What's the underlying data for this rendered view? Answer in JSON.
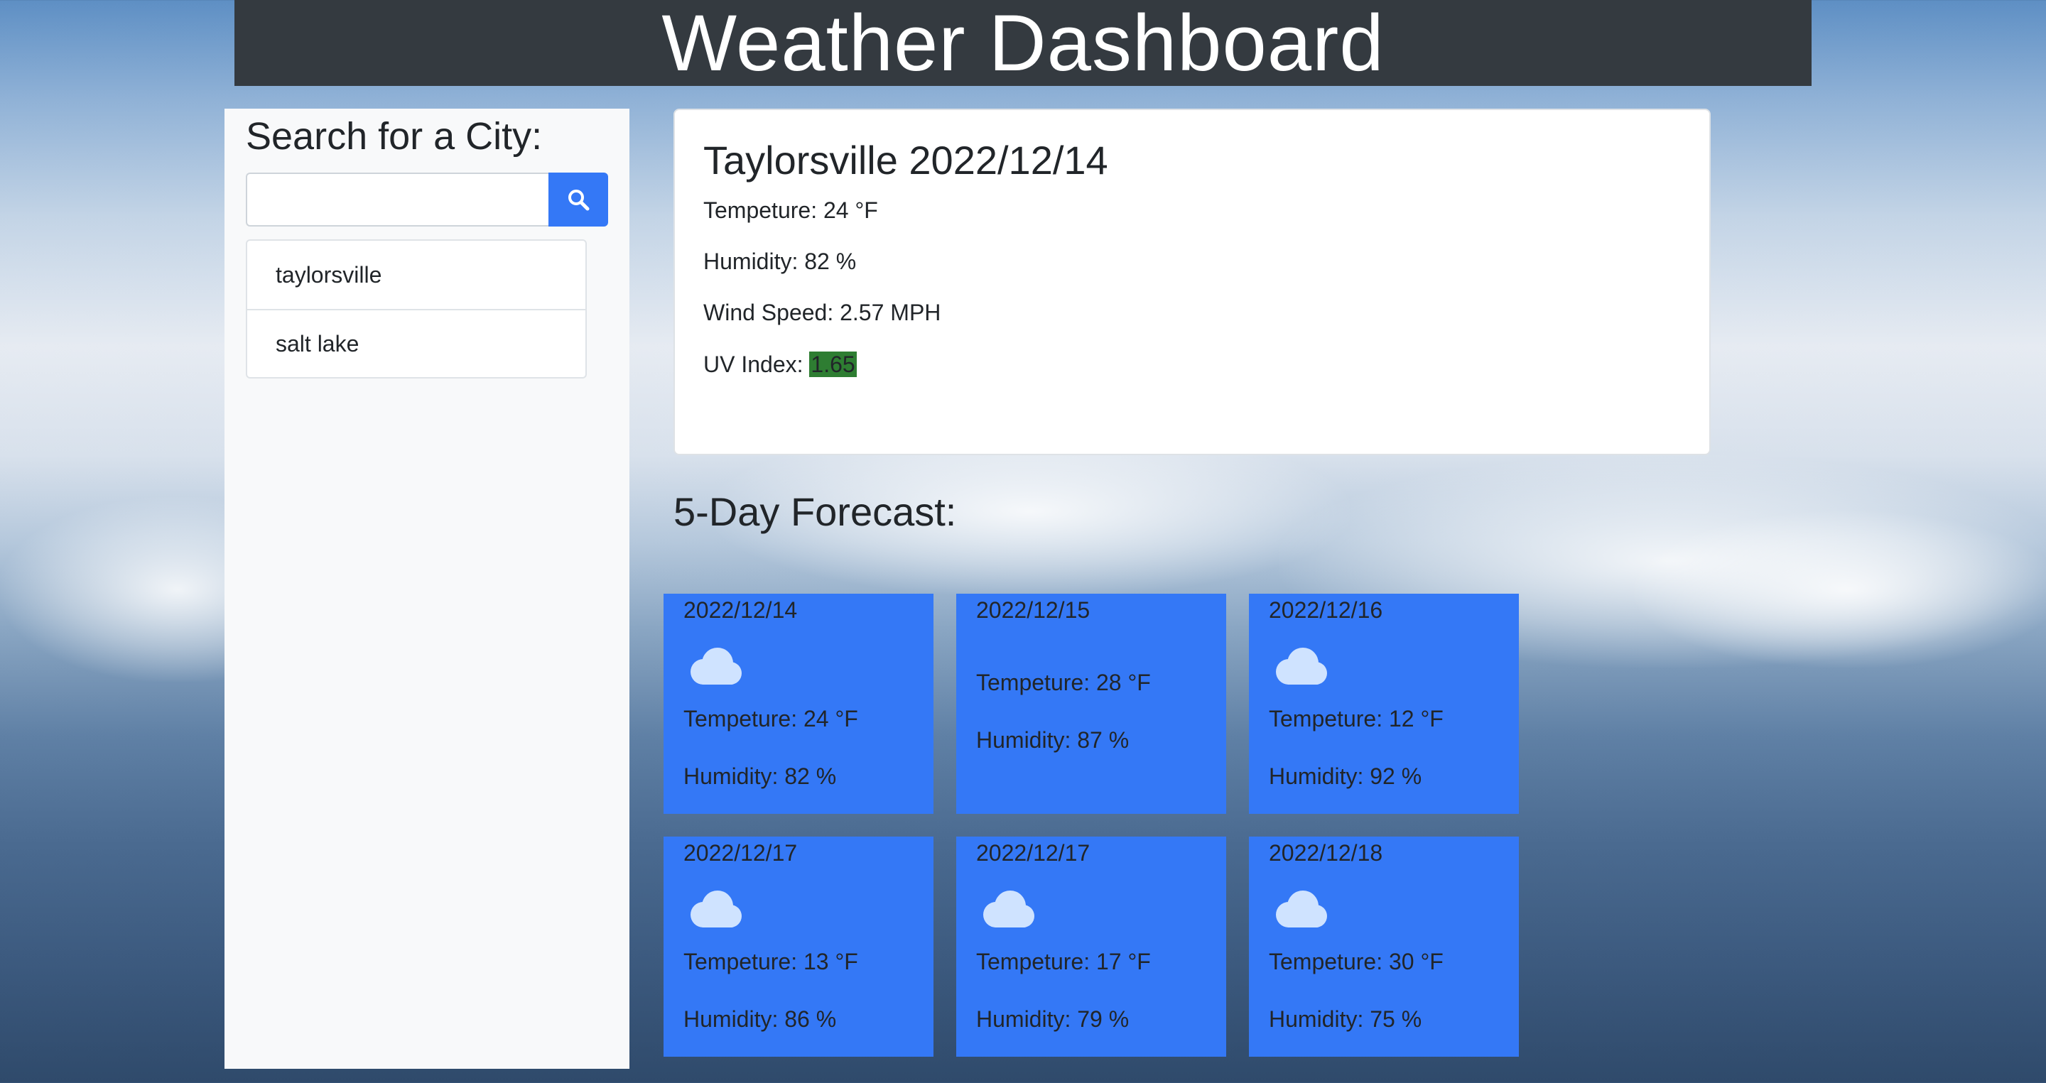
{
  "header": {
    "title": "Weather Dashboard"
  },
  "sidebar": {
    "heading": "Search for a City:",
    "search_placeholder": "",
    "search_value": "",
    "history": [
      {
        "label": "taylorsville"
      },
      {
        "label": "salt lake"
      }
    ]
  },
  "current": {
    "title": "Taylorsville 2022/12/14",
    "temp": "Tempeture: 24 °F",
    "humidity": "Humidity: 82 %",
    "wind": "Wind Speed: 2.57 MPH",
    "uv_label": "UV Index: ",
    "uv_value": "1.65",
    "uv_color": "#2e7d32"
  },
  "forecast": {
    "title": "5-Day Forecast:",
    "cards": [
      {
        "date": "2022/12/14",
        "icon": "cloud-icon",
        "temp": "Tempeture: 24 °F",
        "humidity": "Humidity: 82 %"
      },
      {
        "date": "2022/12/15",
        "icon": "",
        "temp": "Tempeture: 28 °F",
        "humidity": "Humidity: 87 %"
      },
      {
        "date": "2022/12/16",
        "icon": "cloud-icon",
        "temp": "Tempeture: 12 °F",
        "humidity": "Humidity: 92 %"
      },
      {
        "date": "2022/12/17",
        "icon": "cloud-icon",
        "temp": "Tempeture: 13 °F",
        "humidity": "Humidity: 86 %"
      },
      {
        "date": "2022/12/17",
        "icon": "cloud-icon",
        "temp": "Tempeture: 17 °F",
        "humidity": "Humidity: 79 %"
      },
      {
        "date": "2022/12/18",
        "icon": "cloud-icon",
        "temp": "Tempeture: 30 °F",
        "humidity": "Humidity: 75 %"
      }
    ]
  },
  "colors": {
    "header_bg": "#343a40",
    "accent": "#3478f6",
    "sidebar_bg": "#f8f9fa"
  }
}
